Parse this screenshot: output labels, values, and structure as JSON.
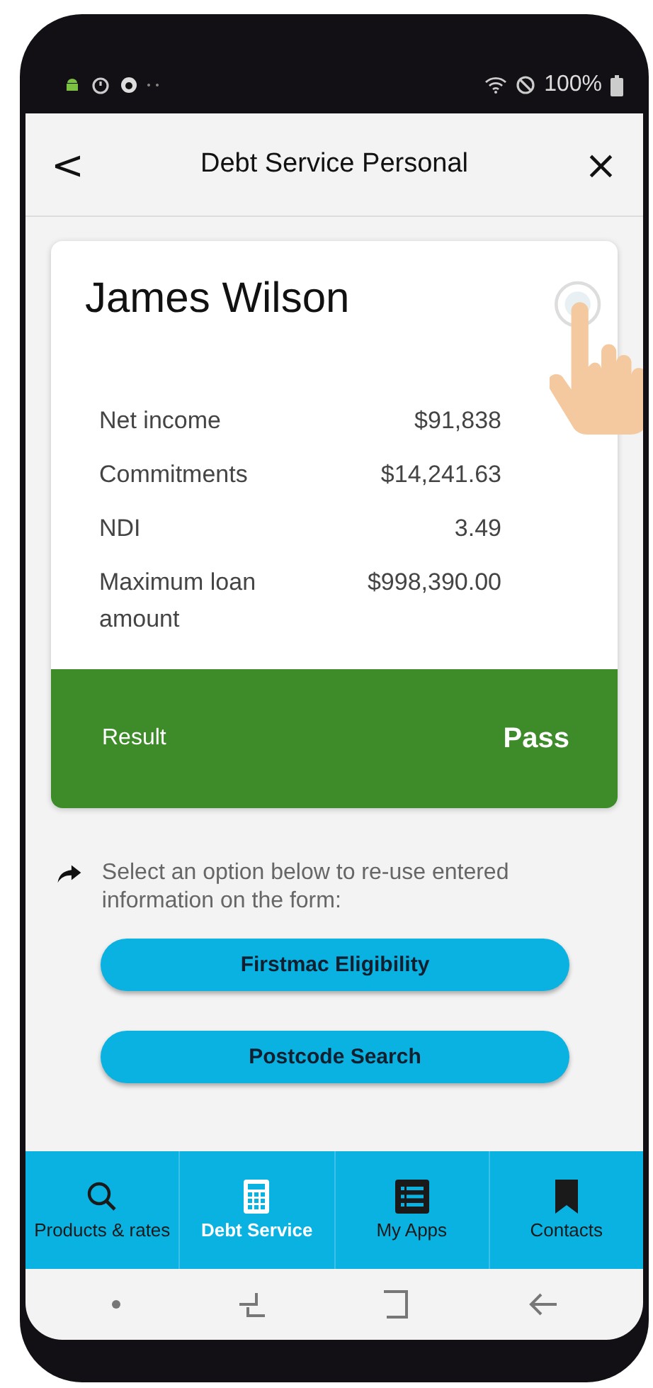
{
  "status_bar": {
    "battery": "100%"
  },
  "app_bar": {
    "back": "<",
    "title": "Debt Service Personal",
    "close": "×"
  },
  "card": {
    "name": "James Wilson",
    "rows": [
      {
        "label": "Net income",
        "value": "$91,838"
      },
      {
        "label": "Commitments",
        "value": "$14,241.63"
      },
      {
        "label": "NDI",
        "value": "3.49"
      },
      {
        "label": "Maximum loan amount",
        "value": "$998,390.00"
      }
    ],
    "result": {
      "label": "Result",
      "value": "Pass"
    }
  },
  "hint": "Select an option below to re-use entered information on the form:",
  "buttons": [
    "Firstmac Eligibility",
    "Postcode Search"
  ],
  "tabs": [
    {
      "label": "Products & rates",
      "selected": false
    },
    {
      "label": "Debt Service",
      "selected": true
    },
    {
      "label": "My Apps",
      "selected": false
    },
    {
      "label": "Contacts",
      "selected": false
    }
  ]
}
